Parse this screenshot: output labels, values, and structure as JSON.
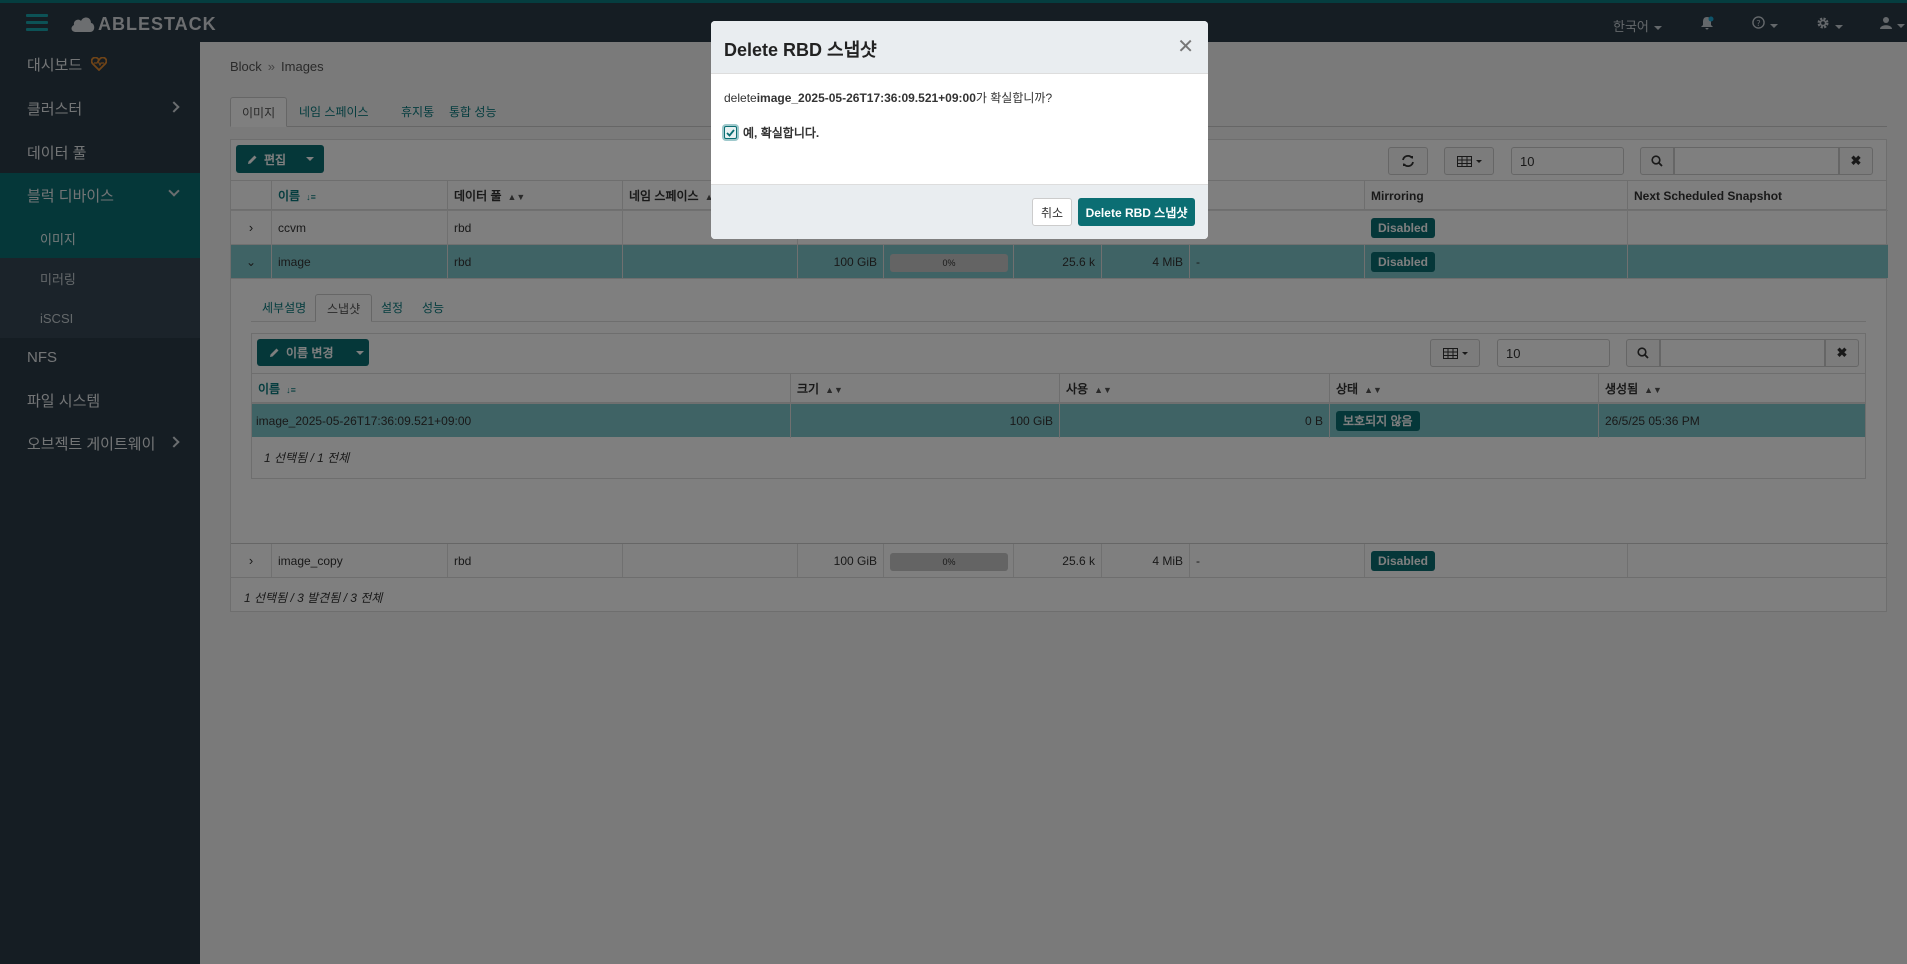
{
  "topbar": {
    "brand": "ABLESTACK",
    "language": "한국어"
  },
  "sidebar": {
    "items": [
      {
        "label": "대시보드"
      },
      {
        "label": "클러스터"
      },
      {
        "label": "데이터 풀"
      },
      {
        "label": "블럭 디바이스"
      },
      {
        "label": "NFS"
      },
      {
        "label": "파일 시스템"
      },
      {
        "label": "오브젝트 게이트웨이"
      }
    ],
    "sub_items": [
      {
        "label": "이미지"
      },
      {
        "label": "미러링"
      },
      {
        "label": "iSCSI"
      }
    ]
  },
  "breadcrumb": {
    "root": "Block",
    "sep": "»",
    "current": "Images"
  },
  "tabs": [
    {
      "label": "이미지"
    },
    {
      "label": "네임 스페이스"
    },
    {
      "label": "휴지통"
    },
    {
      "label": "통합 성능"
    }
  ],
  "toolbar": {
    "edit_label": "편집",
    "page_size": "10"
  },
  "table": {
    "columns": [
      "이름",
      "데이터 풀",
      "네임 스페이스",
      "",
      "",
      "",
      "",
      "",
      "Mirroring",
      "Next Scheduled Snapshot"
    ],
    "rows": [
      {
        "name": "ccvm",
        "pool": "rbd",
        "mirroring": "Disabled"
      },
      {
        "name": "image",
        "pool": "rbd",
        "size": "100 GiB",
        "usage": "0%",
        "objects": "25.6 k",
        "object_size": "4 MiB",
        "parent": "-",
        "mirroring": "Disabled"
      },
      {
        "name": "image_copy",
        "pool": "rbd",
        "size": "100 GiB",
        "usage": "0%",
        "objects": "25.6 k",
        "object_size": "4 MiB",
        "parent": "-",
        "mirroring": "Disabled"
      }
    ],
    "footer": "1 선택됨 / 3 발견됨 / 3 전체"
  },
  "detail": {
    "tabs": [
      {
        "label": "세부설명"
      },
      {
        "label": "스냅샷"
      },
      {
        "label": "설정"
      },
      {
        "label": "성능"
      }
    ],
    "rename_label": "이름 변경",
    "page_size": "10",
    "columns": [
      "이름",
      "크기",
      "사용",
      "상태",
      "생성됨"
    ],
    "rows": [
      {
        "name": "image_2025-05-26T17:36:09.521+09:00",
        "size": "100 GiB",
        "used": "0 B",
        "status": "보호되지 않음",
        "created": "26/5/25 05:36 PM"
      }
    ],
    "footer": "1 선택됨 / 1 전체"
  },
  "modal": {
    "title": "Delete RBD 스냅샷",
    "msg_prefix": "delete",
    "msg_name": "image_2025-05-26T17:36:09.521+09:00",
    "msg_suffix": "가 확실합니까?",
    "confirm_label": "예, 확실합니다.",
    "cancel_label": "취소",
    "submit_label": "Delete RBD 스냅샷"
  },
  "colors": {
    "accent": "#0b6e73",
    "selected_row": "#7fc6ca",
    "sidebar": "#2b3a47"
  }
}
